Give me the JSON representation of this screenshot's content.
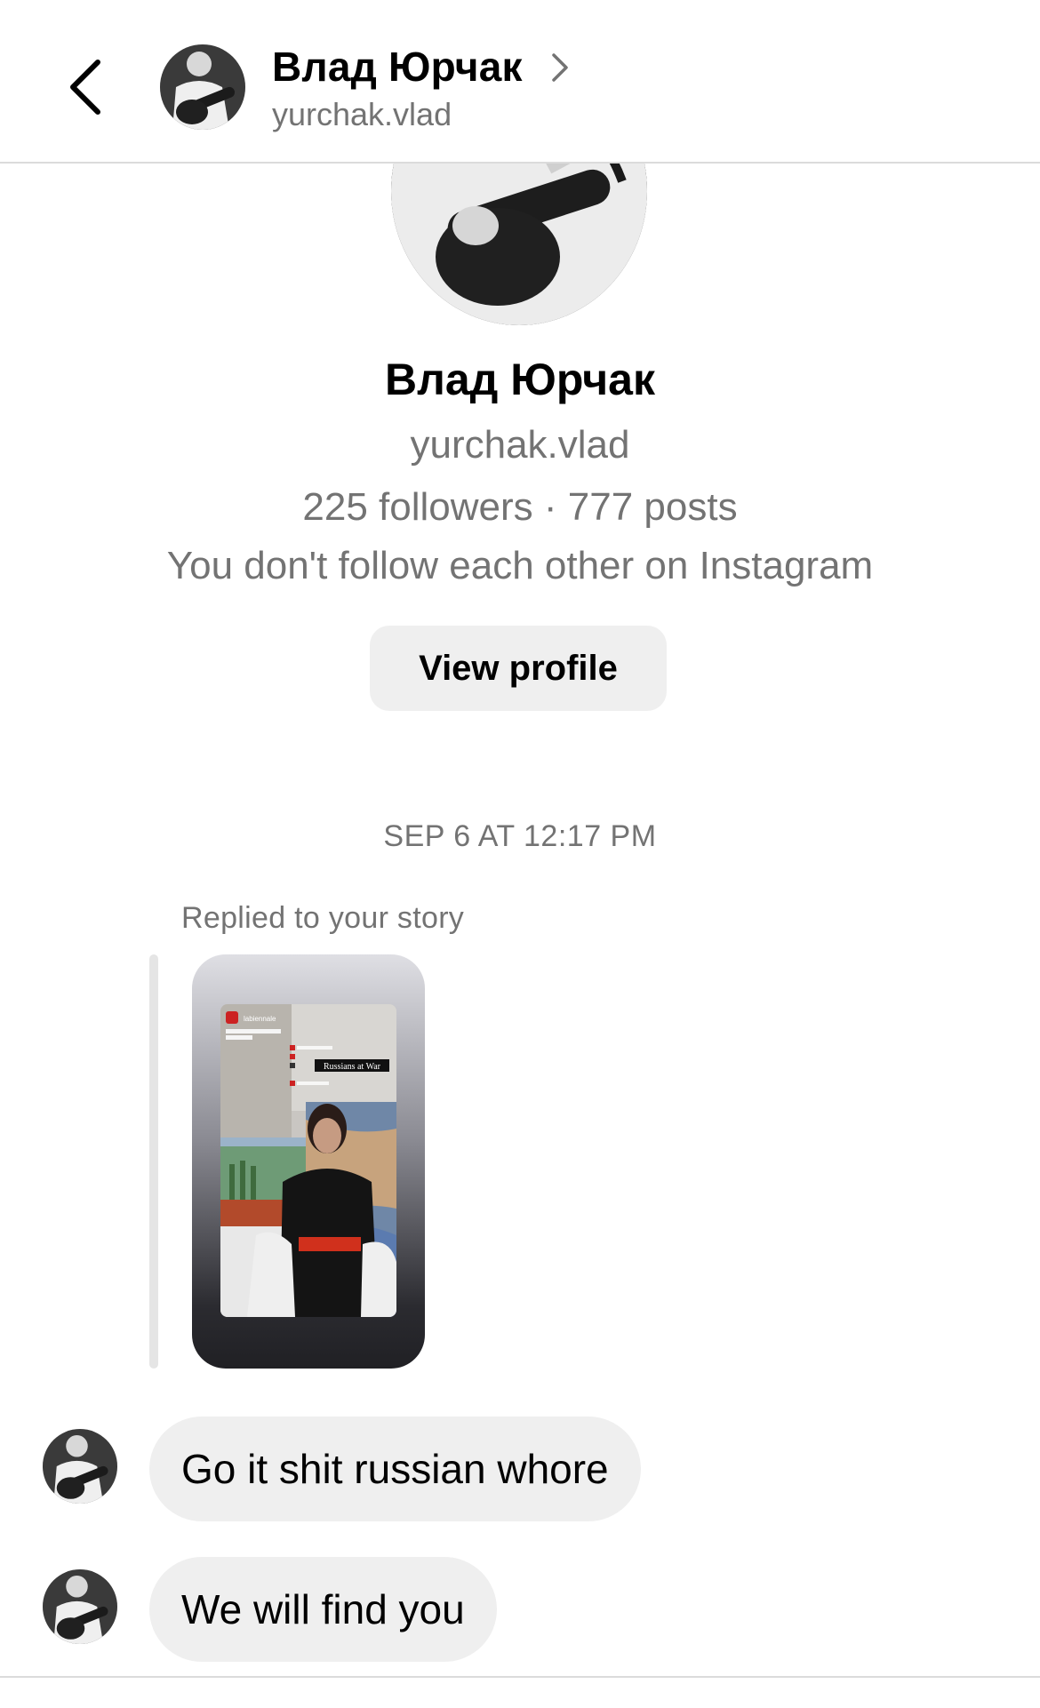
{
  "header": {
    "name": "Влад Юрчак",
    "username": "yurchak.vlad"
  },
  "profile": {
    "name": "Влад Юрчак",
    "username": "yurchak.vlad",
    "stats": "225 followers · 777 posts",
    "follow_note": "You don't follow each other on Instagram",
    "view_profile_label": "View profile"
  },
  "thread": {
    "timestamp": "SEP 6 AT 12:17 PM",
    "reply_label": "Replied to your story",
    "story": {
      "account": "labiennale",
      "caption": "Russians at War"
    },
    "messages": [
      {
        "text": "Go it shit russian whore"
      },
      {
        "text": "We will find you"
      }
    ]
  },
  "icons": {
    "back": "chevron-left-icon",
    "header_chevron": "chevron-right-icon"
  },
  "colors": {
    "secondary_text": "#737373",
    "bubble_bg": "#efefef",
    "button_bg": "#efefef",
    "divider": "#dbdbdb"
  }
}
